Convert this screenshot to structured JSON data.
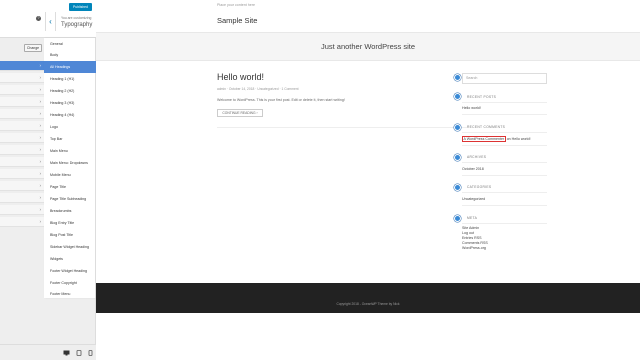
{
  "header": {
    "publish_label": "Published",
    "help_glyph": "?",
    "back_glyph": "‹",
    "customizing_label": "You are customizing",
    "panel_title": "Typography"
  },
  "change_label": "Change",
  "left_nav_chevron": "›",
  "sections": [
    "General",
    "Body",
    "All Headings",
    "Heading 1 (H1)",
    "Heading 2 (H2)",
    "Heading 3 (H3)",
    "Heading 4 (H4)",
    "Logo",
    "Top Bar",
    "Main Menu",
    "Main Menu: Dropdowns",
    "Mobile Menu",
    "Page Title",
    "Page Title Subheading",
    "Breadcrumbs",
    "Blog Entry Title",
    "Blog Post Title",
    "Sidebar Widget Heading",
    "Widgets",
    "Footer Widget Heading",
    "Footer Copyright",
    "Footer Menu"
  ],
  "site": {
    "topbar_text": "Place your content here",
    "title": "Sample Site",
    "tagline": "Just another WordPress site"
  },
  "post": {
    "title": "Hello world!",
    "meta": "admin · October 14, 2018 · Uncategorized · 1 Comment",
    "excerpt": "Welcome to WordPress. This is your first post. Edit or delete it, then start writing!",
    "continue_label": "CONTINUE READING ›"
  },
  "sidebar": {
    "search_placeholder": "Search",
    "recent_posts_heading": "RECENT POSTS",
    "recent_post_1": "Hello world!",
    "recent_comments_heading": "RECENT COMMENTS",
    "recent_comment_author": "A WordPress Commenter",
    "recent_comment_suffix": "on Hello world!",
    "archives_heading": "ARCHIVES",
    "archive_1": "October 2018",
    "categories_heading": "CATEGORIES",
    "category_1": "Uncategorized",
    "meta_heading": "META",
    "meta_links": [
      "Site Admin",
      "Log out",
      "Entries RSS",
      "Comments RSS",
      "WordPress.org"
    ]
  },
  "footer": {
    "copyright": "Copyright 2018 - OceanWP Theme by Nick"
  },
  "colors": {
    "accent": "#4f87d6",
    "publish": "#0085ba",
    "footer_bg": "#222222"
  }
}
